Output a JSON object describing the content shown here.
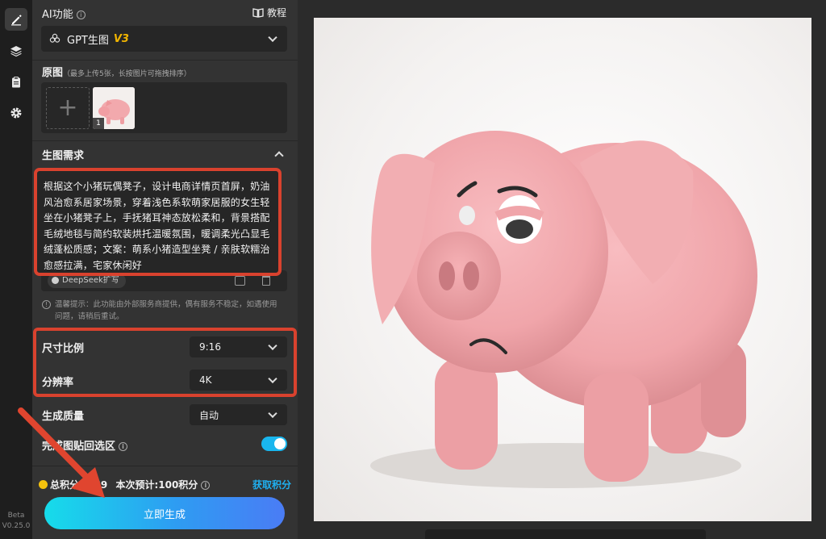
{
  "app": {
    "version_tag": "Beta",
    "version": "V0.25.0"
  },
  "ai_function": {
    "title": "AI功能",
    "tutorial_label": "教程",
    "model_name": "GPT生图",
    "model_badge": "V3"
  },
  "source_image": {
    "title": "原图",
    "hint": "（最多上传5张，长按图片可拖拽排序）",
    "add_symbol": "+",
    "thumb_index": "1"
  },
  "requirements": {
    "title": "生图需求",
    "prompt": "根据这个小猪玩偶凳子，设计电商详情页首屏，奶油风治愈系居家场景，穿着浅色系软萌家居服的女生轻坐在小猪凳子上，手抚猪耳神态放松柔和，背景搭配毛绒地毯与简约软装烘托温暖氛围，暖调柔光凸显毛绒蓬松质感；文案：萌系小猪造型坐凳 / 亲肤软糯治愈感拉满，宅家休闲好",
    "deepseek_label": "DeepSeek扩写",
    "tip": "温馨提示：此功能由外部服务商提供，偶有服务不稳定，如遇使用问题，请稍后重试。"
  },
  "settings": {
    "ratio_label": "尺寸比例",
    "ratio_value": "9:16",
    "resolution_label": "分辨率",
    "resolution_value": "4K",
    "quality_label": "生成质量",
    "quality_value": "自动",
    "paste_back_label": "完成图贴回选区",
    "paste_back_on": true
  },
  "points": {
    "total_label": "总积分",
    "total_value": "969",
    "estimate_label": "本次预计:100积分",
    "get_points": "获取积分"
  },
  "generate_label": "立即生成",
  "colors": {
    "accent": "#19b6ee",
    "annotation_red": "#d9422e",
    "badge_gold": "#f0b400"
  }
}
